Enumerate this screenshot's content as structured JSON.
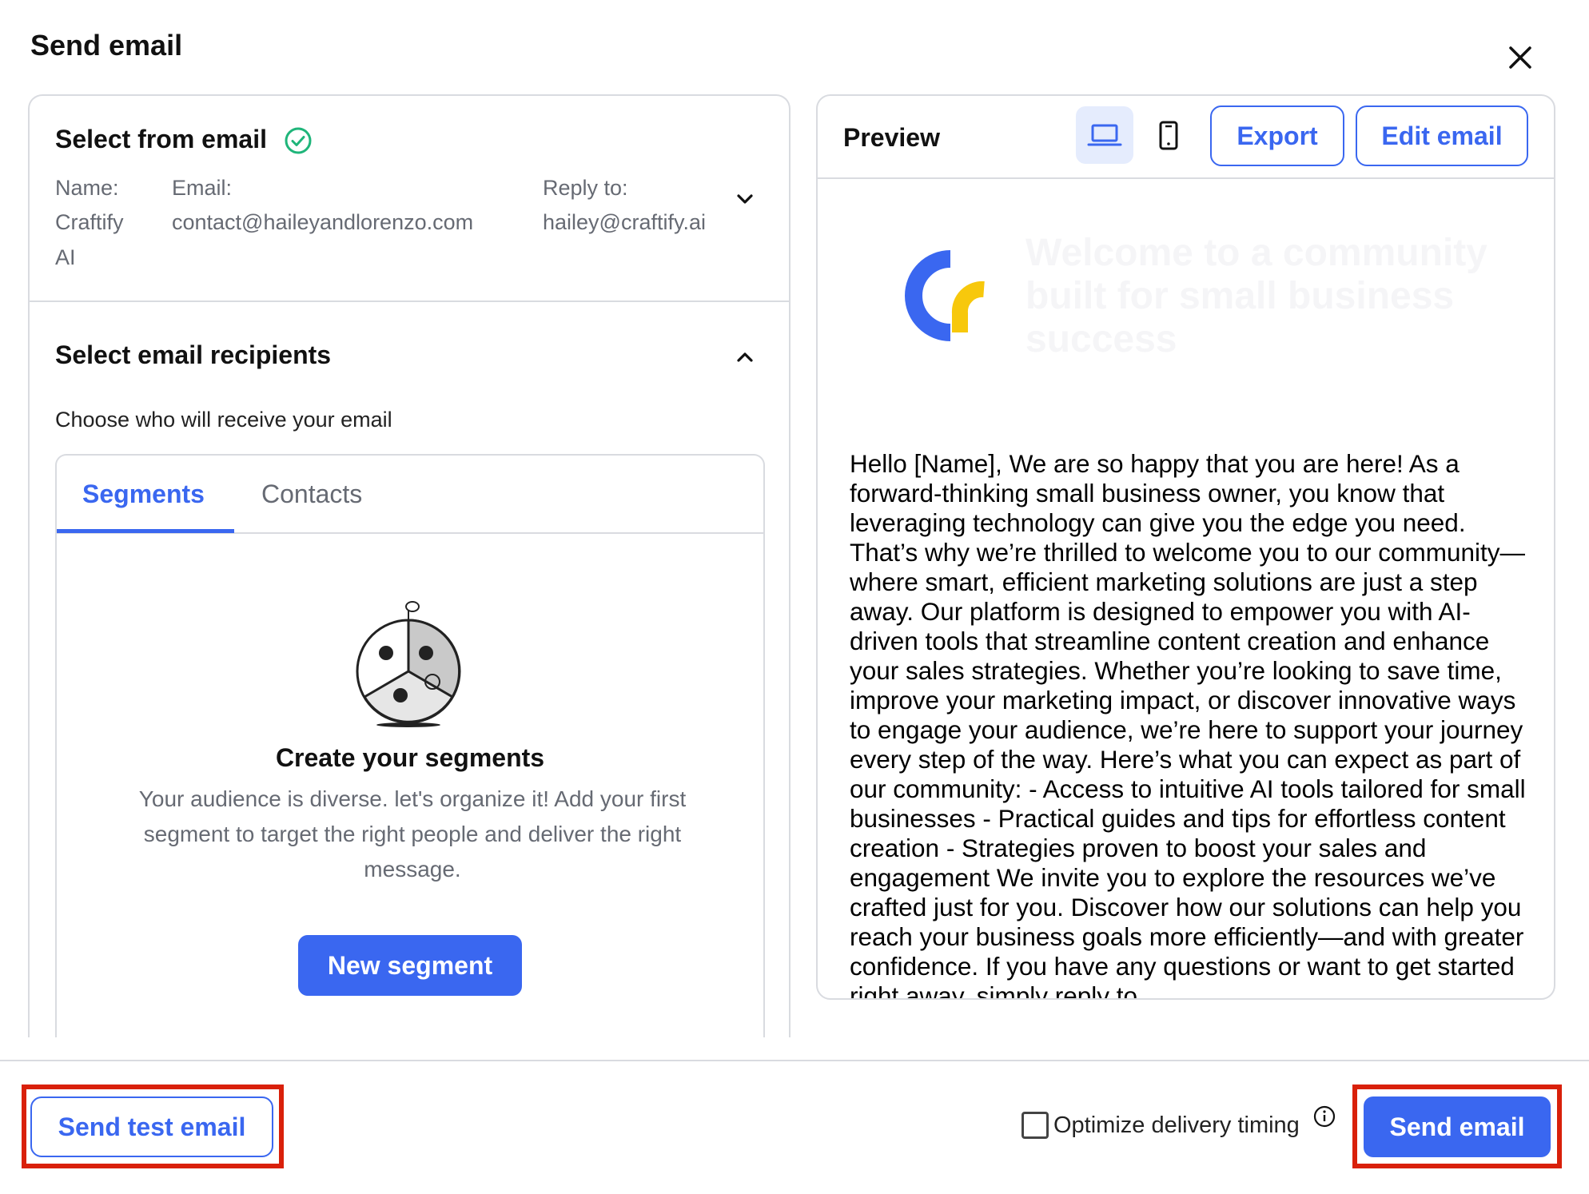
{
  "modal": {
    "title": "Send email",
    "close_icon": "close-icon"
  },
  "from_section": {
    "title": "Select from email",
    "name_label": "Name:",
    "name_value_line1": "Craftify",
    "name_value_line2": "AI",
    "email_label": "Email:",
    "email_value": "contact@haileyandlorenzo.com",
    "reply_label": "Reply to:",
    "reply_value": "hailey@craftify.ai"
  },
  "recipients_section": {
    "title": "Select email recipients",
    "subtitle": "Choose who will receive your email",
    "tabs": [
      {
        "label": "Segments",
        "active": true
      },
      {
        "label": "Contacts",
        "active": false
      }
    ],
    "empty_state": {
      "title": "Create your segments",
      "description": "Your audience is diverse. let's organize it! Add your first segment to target the right people and deliver the right message.",
      "button_label": "New segment"
    }
  },
  "preview": {
    "title": "Preview",
    "desktop_icon": "laptop-icon",
    "mobile_icon": "phone-icon",
    "export_label": "Export",
    "edit_label": "Edit email",
    "hero_text": "Welcome to a community built for small business success",
    "body_text": "Hello [Name], We are so happy that you are here! As a forward-thinking small business owner, you know that leveraging technology can give you the edge you need. That’s why we’re thrilled to welcome you to our community—where smart, efficient marketing solutions are just a step away. Our platform is designed to empower you with AI-driven tools that streamline content creation and enhance your sales strategies. Whether you’re looking to save time, improve your marketing impact, or discover innovative ways to engage your audience, we’re here to support your journey every step of the way. Here’s what you can expect as part of our community: - Access to intuitive AI tools tailored for small businesses - Practical guides and tips for effortless content creation - Strategies proven to boost your sales and engagement We invite you to explore the resources we’ve crafted just for you. Discover how our solutions can help you reach your business goals more efficiently—and with greater confidence. If you have any questions or want to get started right away, simply reply to"
  },
  "footer": {
    "test_button": "Send test email",
    "optimize_label": "Optimize delivery timing",
    "optimize_checked": false,
    "send_button": "Send email"
  },
  "colors": {
    "accent": "#3a67f0",
    "highlight": "#d9200a",
    "success": "#1fb57a",
    "logo_yellow": "#f7c80c"
  }
}
